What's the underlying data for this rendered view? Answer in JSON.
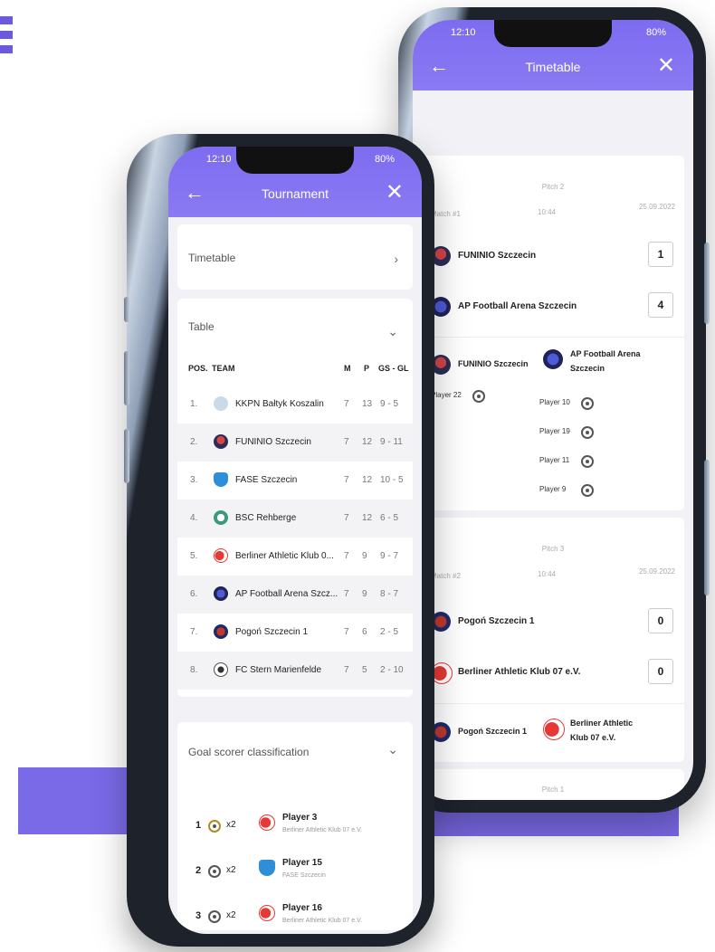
{
  "colors": {
    "accent": "#7b6ae8",
    "appbar": "#8373f2",
    "phone_frame": "#1d222b"
  },
  "front_phone": {
    "status": {
      "time": "12:10",
      "battery": "80%"
    },
    "appbar": {
      "title": "Tournament",
      "back_icon": "arrow-left-icon",
      "close_icon": "close-icon"
    },
    "timetable_label": "Timetable",
    "table": {
      "label": "Table",
      "headers": {
        "pos": "POS.",
        "team": "TEAM",
        "m": "M",
        "p": "P",
        "gs": "GS - GL"
      },
      "rows": [
        {
          "pos": "1.",
          "team": "KKPN Bałtyk Koszalin",
          "m": "7",
          "p": "13",
          "gs": "9 - 5"
        },
        {
          "pos": "2.",
          "team": "FUNINIO Szczecin",
          "m": "7",
          "p": "12",
          "gs": "9 - 11"
        },
        {
          "pos": "3.",
          "team": "FASE Szczecin",
          "m": "7",
          "p": "12",
          "gs": "10 - 5"
        },
        {
          "pos": "4.",
          "team": "BSC Rehberge",
          "m": "7",
          "p": "12",
          "gs": "6 - 5"
        },
        {
          "pos": "5.",
          "team": "Berliner Athletic Klub 0...",
          "m": "7",
          "p": "9",
          "gs": "9 - 7"
        },
        {
          "pos": "6.",
          "team": "AP Football Arena Szcz...",
          "m": "7",
          "p": "9",
          "gs": "8 - 7"
        },
        {
          "pos": "7.",
          "team": "Pogoń Szczecin 1",
          "m": "7",
          "p": "6",
          "gs": "2 - 5"
        },
        {
          "pos": "8.",
          "team": "FC Stern Marienfelde",
          "m": "7",
          "p": "5",
          "gs": "2 - 10"
        }
      ]
    },
    "scorers": {
      "label": "Goal scorer classification",
      "items": [
        {
          "rank": "1",
          "goals": "x2",
          "player": "Player 3",
          "team": "Berliner Athletic Klub 07 e.V."
        },
        {
          "rank": "2",
          "goals": "x2",
          "player": "Player 15",
          "team": "FASE Szczecin"
        },
        {
          "rank": "3",
          "goals": "x2",
          "player": "Player 16",
          "team": "Berliner Athletic Klub 07 e.V."
        }
      ]
    }
  },
  "back_phone": {
    "status": {
      "time": "12:10",
      "battery": "80%"
    },
    "appbar": {
      "title": "Timetable",
      "back_icon": "arrow-left-icon",
      "close_icon": "close-icon"
    },
    "matches": [
      {
        "pitch": "Pitch 2",
        "match": "Match #1",
        "time": "10:44",
        "date": "25.09.2022",
        "home": "FUNINIO Szczecin",
        "home_score": "1",
        "away": "AP Football Arena Szczecin",
        "away_score": "4",
        "home_label": "FUNINIO Szczecin",
        "away_label_1": "AP Football Arena",
        "away_label_2": "Szczecin",
        "home_goals": [
          {
            "player": "Player 22",
            "count": "x1"
          }
        ],
        "away_goals": [
          {
            "player": "Player 10",
            "count": "x1"
          },
          {
            "player": "Player 19",
            "count": "x1"
          },
          {
            "player": "Player 11",
            "count": "x1"
          },
          {
            "player": "Player 9",
            "count": "x1"
          }
        ]
      },
      {
        "pitch": "Pitch 3",
        "match": "Match #2",
        "time": "10:44",
        "date": "25.09.2022",
        "home": "Pogoń Szczecin 1",
        "home_score": "0",
        "away": "Berliner Athletic Klub 07 e.V.",
        "away_score": "0",
        "home_label": "Pogoń Szczecin 1",
        "away_label_1": "Berliner Athletic",
        "away_label_2": "Klub 07 e.V."
      }
    ],
    "next_pitch": "Pitch 1"
  }
}
